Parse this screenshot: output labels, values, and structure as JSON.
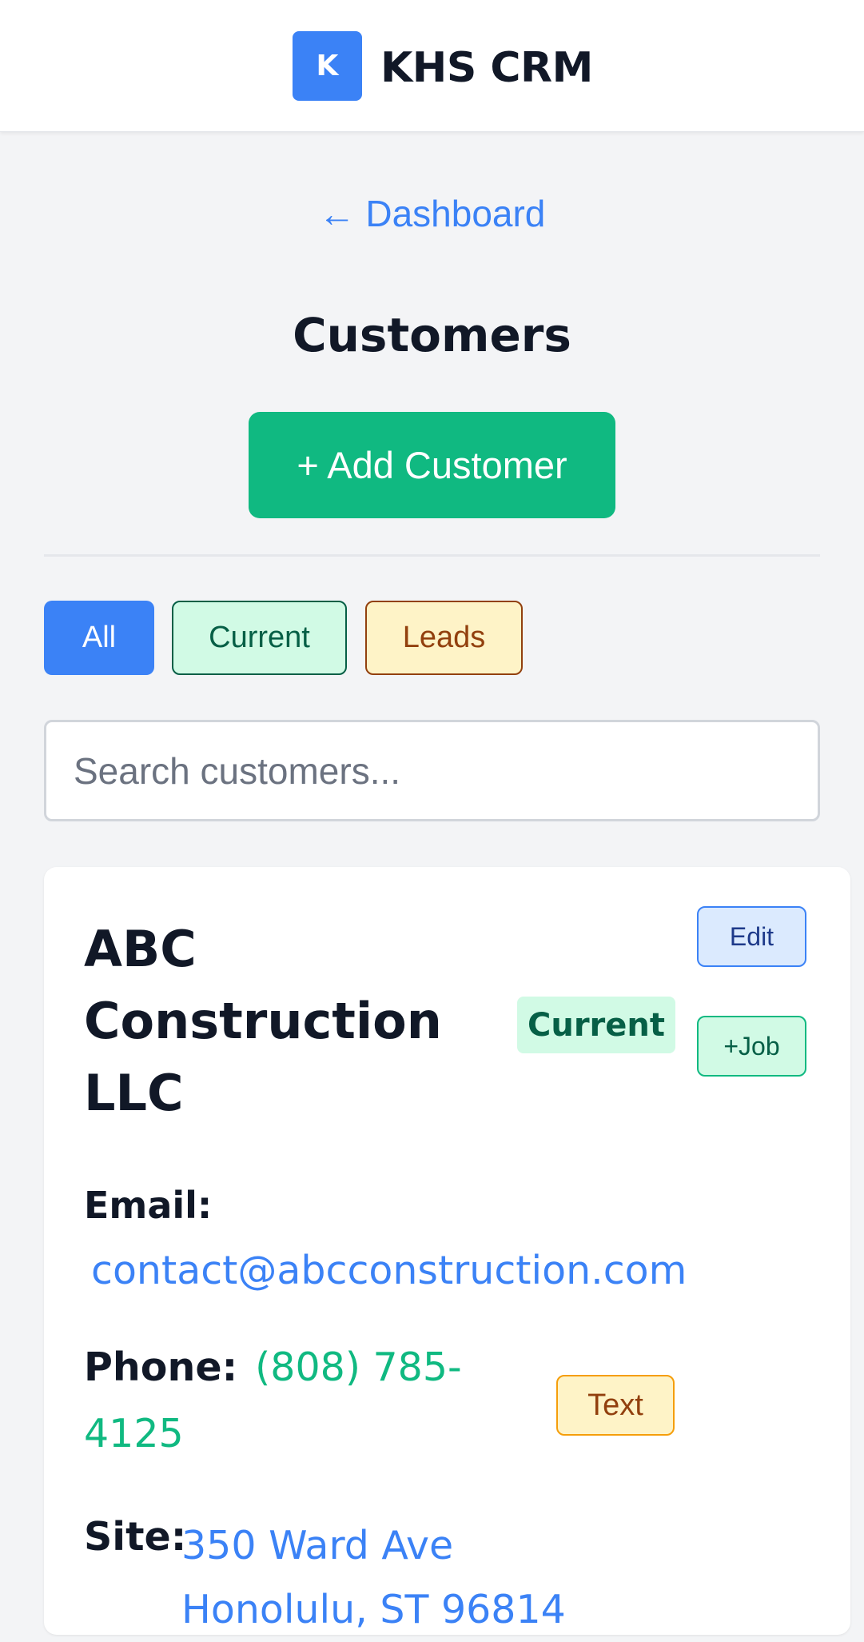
{
  "header": {
    "logo_letter": "K",
    "app_title": "KHS CRM"
  },
  "nav": {
    "back_label": "← Dashboard"
  },
  "page": {
    "title": "Customers",
    "add_button_label": "+ Add Customer"
  },
  "filters": {
    "all": "All",
    "current": "Current",
    "leads": "Leads",
    "selected": "All"
  },
  "search": {
    "placeholder": "Search customers...",
    "value": ""
  },
  "customers": [
    {
      "name": "ABC Construction LLC",
      "status": "Current",
      "edit_label": "Edit",
      "job_label": "+Job",
      "email_label": "Email:",
      "email": "contact@abcconstruction.com",
      "phone_label": "Phone:",
      "phone": "(808) 785-4125",
      "text_label": "Text",
      "site_label": "Site:",
      "site": "350 Ward Ave Honolulu, ST 96814"
    }
  ],
  "colors": {
    "accent": "#3b82f6",
    "success": "#10b981",
    "warning": "#f59e0b"
  }
}
